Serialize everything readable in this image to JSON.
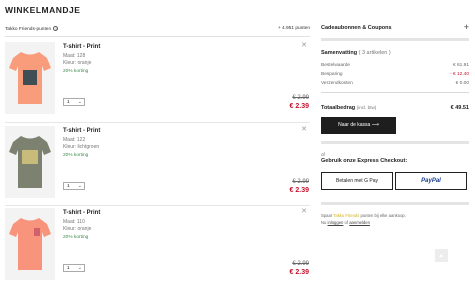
{
  "page": {
    "title": "WINKELMANDJE"
  },
  "points": {
    "label": "Takko Friends-punten",
    "value": "+ 4.951 punten"
  },
  "items": [
    {
      "name": "T-shirt - Print",
      "size": "Maat: 128",
      "color": "Kleur: oranje",
      "discount": "20% korting",
      "qty": "1",
      "old_price": "€ 2.99",
      "new_price": "€ 2.39",
      "shirt_color": "#f89c7c",
      "print_color": "#3f4d55"
    },
    {
      "name": "T-shirt - Print",
      "size": "Maat: 122",
      "color": "Kleur: lichtgroen",
      "discount": "20% korting",
      "qty": "1",
      "old_price": "€ 2.99",
      "new_price": "€ 2.39",
      "shirt_color": "#7d8270",
      "print_color": "#c9bb7a"
    },
    {
      "name": "T-shirt - Print",
      "size": "Maat: 110",
      "color": "Kleur: oranje",
      "discount": "20% korting",
      "qty": "1",
      "old_price": "€ 2.99",
      "new_price": "€ 2.39",
      "shirt_color": "#f8947c",
      "print_color": "#d2606a"
    }
  ],
  "gift": {
    "label": "Cadeaubonnen & Coupons"
  },
  "summary": {
    "title": "Samenvatting",
    "count": "( 3 artikelen )",
    "rows": [
      {
        "label": "Bestelwaarde",
        "value": "€ 61.91"
      },
      {
        "label": "Besparing",
        "value": "- € 12.40"
      },
      {
        "label": "Verzendkosten",
        "value": "€ 0.00"
      }
    ],
    "total_label": "Totaalbedrag",
    "total_sub": "(incl. btw)",
    "total_value": "€ 49.51",
    "checkout_label": "Naar de kassa"
  },
  "express": {
    "or": "of",
    "title": "Gebruik onze Express Checkout:",
    "gpay_label": "Betalen met G Pay",
    "paypal_label": "PayPal"
  },
  "promo": {
    "line1_pre": "Spaar ",
    "line1_hl": "Takko Friends",
    "line1_post": " punten bij elke aankoop.",
    "line2_pre": "Nu ",
    "line2_link1": "inloggen",
    "line2_mid": " of ",
    "line2_link2": "aanmelden"
  },
  "colors": {
    "price_red": "#c4122f",
    "discount_green": "#3e8a4e",
    "button_dark": "#1e1e1e",
    "paypal_blue": "#1a3d8f"
  },
  "icons": {
    "close": "close-icon",
    "info": "info-icon",
    "plus": "plus-icon",
    "arrow": "arrow-right-icon",
    "chevron": "chevron-down-icon",
    "scroll_top": "arrow-up-icon"
  }
}
